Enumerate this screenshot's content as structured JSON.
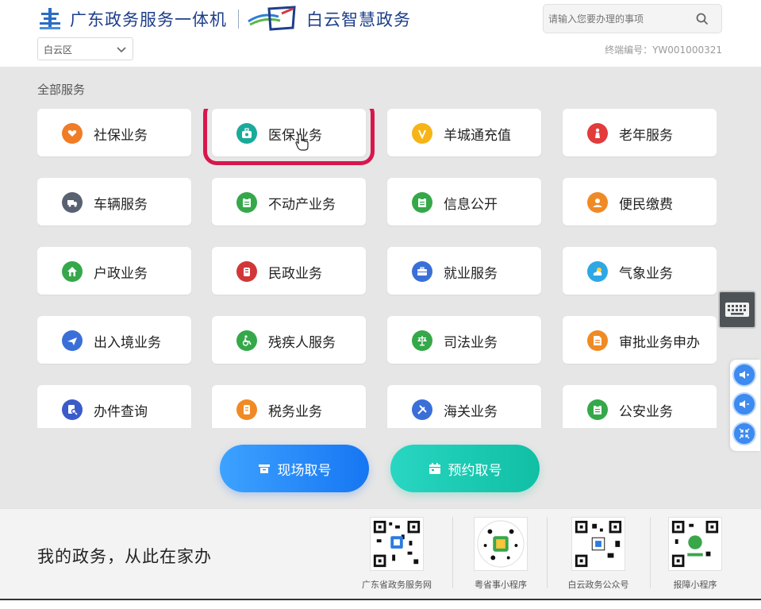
{
  "header": {
    "brand_primary": "广东政务服务一体机",
    "brand_secondary": "白云智慧政务",
    "district_value": "白云区",
    "search_placeholder": "请输入您要办理的事项",
    "terminal_label": "终端编号：YW001000321"
  },
  "main": {
    "section_title": "全部服务",
    "services": [
      {
        "label": "社保业务",
        "color": "#f07c26",
        "icon": "heart-hands-icon"
      },
      {
        "label": "医保业务",
        "color": "#1aaa9a",
        "icon": "medical-bag-icon",
        "highlighted": true
      },
      {
        "label": "羊城通充值",
        "color": "#f7b416",
        "icon": "v-card-icon"
      },
      {
        "label": "老年服务",
        "color": "#e23b3b",
        "icon": "elderly-icon"
      },
      {
        "label": "车辆服务",
        "color": "#5a6272",
        "icon": "truck-icon"
      },
      {
        "label": "不动产业务",
        "color": "#35a84a",
        "icon": "clipboard-icon"
      },
      {
        "label": "信息公开",
        "color": "#35a84a",
        "icon": "clipboard-icon"
      },
      {
        "label": "便民缴费",
        "color": "#f08a24",
        "icon": "payment-icon"
      },
      {
        "label": "户政业务",
        "color": "#35a84a",
        "icon": "house-icon"
      },
      {
        "label": "民政业务",
        "color": "#d23737",
        "icon": "civil-affairs-icon"
      },
      {
        "label": "就业服务",
        "color": "#3a6fd8",
        "icon": "briefcase-icon"
      },
      {
        "label": "气象业务",
        "color": "#2ea7e6",
        "icon": "weather-icon"
      },
      {
        "label": "出入境业务",
        "color": "#3a6fd8",
        "icon": "plane-icon"
      },
      {
        "label": "残疾人服务",
        "color": "#35a84a",
        "icon": "wheelchair-icon"
      },
      {
        "label": "司法业务",
        "color": "#35a84a",
        "icon": "scales-icon"
      },
      {
        "label": "审批业务申办",
        "color": "#f08a24",
        "icon": "document-icon"
      },
      {
        "label": "办件查询",
        "color": "#3a5bc8",
        "icon": "doc-search-icon"
      },
      {
        "label": "税务业务",
        "color": "#f08a24",
        "icon": "tax-icon"
      },
      {
        "label": "海关业务",
        "color": "#3a6fd8",
        "icon": "tools-icon"
      },
      {
        "label": "公安业务",
        "color": "#35a84a",
        "icon": "clipboard-icon"
      }
    ],
    "take_number_label": "现场取号",
    "book_number_label": "预约取号"
  },
  "footer": {
    "slogan": "我的政务，从此在家办",
    "qr_codes": [
      {
        "label": "广东省政务服务网"
      },
      {
        "label": "粤省事小程序"
      },
      {
        "label": "白云政务公众号"
      },
      {
        "label": "报障小程序"
      }
    ]
  },
  "colors": {
    "take_button": "#1676f3",
    "book_button": "#10bfa4",
    "highlight": "#d7174c",
    "brand": "#1d3f8a"
  }
}
